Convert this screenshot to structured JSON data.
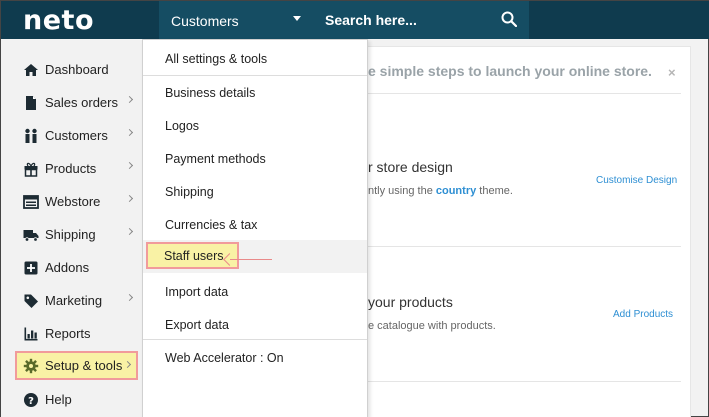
{
  "header": {
    "logo": "neto",
    "search_scope": "Customers",
    "search_placeholder": "Search here..."
  },
  "sidebar": {
    "items": [
      {
        "label": "Dashboard",
        "icon": "home-icon"
      },
      {
        "label": "Sales orders",
        "icon": "document-icon"
      },
      {
        "label": "Customers",
        "icon": "people-icon"
      },
      {
        "label": "Products",
        "icon": "gift-icon"
      },
      {
        "label": "Webstore",
        "icon": "browser-icon"
      },
      {
        "label": "Shipping",
        "icon": "truck-icon"
      },
      {
        "label": "Addons",
        "icon": "plus-box-icon"
      },
      {
        "label": "Marketing",
        "icon": "tag-icon"
      },
      {
        "label": "Reports",
        "icon": "bar-chart-icon"
      },
      {
        "label": "Setup & tools",
        "icon": "gear-icon"
      },
      {
        "label": "Help",
        "icon": "help-icon"
      }
    ]
  },
  "dropdown": {
    "items": [
      "All settings & tools",
      "Business details",
      "Logos",
      "Payment methods",
      "Shipping",
      "Currencies & tax",
      "Staff users",
      "Import data",
      "Export data",
      "Web Accelerator : On"
    ]
  },
  "main": {
    "banner": "e simple steps to launch your online store.",
    "close": "×",
    "step1": {
      "title": "r store design",
      "desc_prefix": "ntly using the ",
      "desc_link": "country",
      "desc_suffix": " theme.",
      "action": "Customise Design"
    },
    "step2": {
      "title": "your products",
      "desc": "e catalogue with products.",
      "action": "Add Products"
    }
  },
  "colors": {
    "topbar": "#0f3b4e",
    "search_bar": "#154d63",
    "highlight_fill": "#f9f2a5",
    "highlight_border": "#f19b9b",
    "link": "#2e8fd3"
  }
}
